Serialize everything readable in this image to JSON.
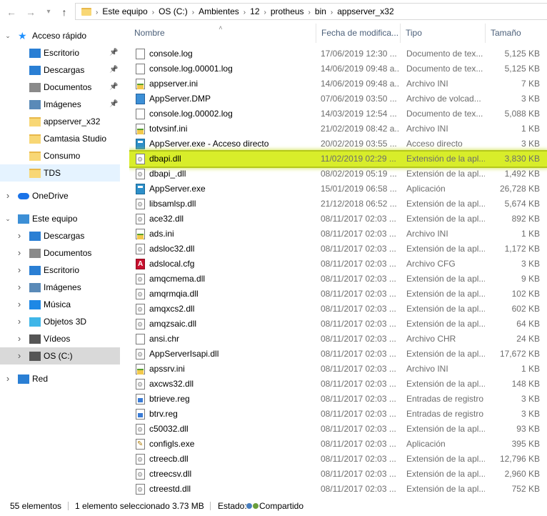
{
  "address": {
    "crumbs": [
      "Este equipo",
      "OS (C:)",
      "Ambientes",
      "12",
      "protheus",
      "bin",
      "appserver_x32"
    ]
  },
  "nav": {
    "items": [
      {
        "label": "Acceso rápido",
        "icon": "star-icon",
        "level": 0,
        "chevron": "expanded",
        "pinned": false,
        "state": ""
      },
      {
        "label": "Escritorio",
        "icon": "desktop-icon",
        "level": 1,
        "chevron": "",
        "pinned": true,
        "state": ""
      },
      {
        "label": "Descargas",
        "icon": "download-icon",
        "level": 1,
        "chevron": "",
        "pinned": true,
        "state": ""
      },
      {
        "label": "Documentos",
        "icon": "documents-icon",
        "level": 1,
        "chevron": "",
        "pinned": true,
        "state": ""
      },
      {
        "label": "Imágenes",
        "icon": "pictures-icon",
        "level": 1,
        "chevron": "",
        "pinned": true,
        "state": ""
      },
      {
        "label": "appserver_x32",
        "icon": "folder-icon",
        "level": 1,
        "chevron": "",
        "pinned": false,
        "state": ""
      },
      {
        "label": "Camtasia Studio",
        "icon": "folder-icon",
        "level": 1,
        "chevron": "",
        "pinned": false,
        "state": ""
      },
      {
        "label": "Consumo",
        "icon": "folder-icon",
        "level": 1,
        "chevron": "",
        "pinned": false,
        "state": ""
      },
      {
        "label": "TDS",
        "icon": "folder-icon",
        "level": 1,
        "chevron": "",
        "pinned": false,
        "state": "hover"
      },
      {
        "label": "OneDrive",
        "icon": "cloud-icon",
        "level": 0,
        "chevron": "collapsed",
        "pinned": false,
        "state": ""
      },
      {
        "label": "Este equipo",
        "icon": "computer-icon",
        "level": 0,
        "chevron": "expanded",
        "pinned": false,
        "state": ""
      },
      {
        "label": "Descargas",
        "icon": "download-icon",
        "level": 1,
        "chevron": "collapsed",
        "pinned": false,
        "state": ""
      },
      {
        "label": "Documentos",
        "icon": "documents-icon",
        "level": 1,
        "chevron": "collapsed",
        "pinned": false,
        "state": ""
      },
      {
        "label": "Escritorio",
        "icon": "desktop-icon",
        "level": 1,
        "chevron": "collapsed",
        "pinned": false,
        "state": ""
      },
      {
        "label": "Imágenes",
        "icon": "pictures-icon",
        "level": 1,
        "chevron": "collapsed",
        "pinned": false,
        "state": ""
      },
      {
        "label": "Música",
        "icon": "music-icon",
        "level": 1,
        "chevron": "collapsed",
        "pinned": false,
        "state": ""
      },
      {
        "label": "Objetos 3D",
        "icon": "cube-icon",
        "level": 1,
        "chevron": "collapsed",
        "pinned": false,
        "state": ""
      },
      {
        "label": "Vídeos",
        "icon": "video-icon",
        "level": 1,
        "chevron": "collapsed",
        "pinned": false,
        "state": ""
      },
      {
        "label": "OS (C:)",
        "icon": "drive-icon",
        "level": 1,
        "chevron": "collapsed",
        "pinned": false,
        "state": "selected"
      },
      {
        "label": "Red",
        "icon": "network-icon",
        "level": 0,
        "chevron": "collapsed",
        "pinned": false,
        "state": ""
      }
    ]
  },
  "columns": {
    "name": "Nombre",
    "date": "Fecha de modifica...",
    "type": "Tipo",
    "size": "Tamaño"
  },
  "files": [
    {
      "name": "console.log",
      "date": "17/06/2019 12:30 ...",
      "type": "Documento de tex...",
      "size": "5,125 KB",
      "icon": "doc"
    },
    {
      "name": "console.log.00001.log",
      "date": "14/06/2019 09:48 a...",
      "type": "Documento de tex...",
      "size": "5,125 KB",
      "icon": "doc"
    },
    {
      "name": "appserver.ini",
      "date": "14/06/2019 09:48 a...",
      "type": "Archivo INI",
      "size": "7 KB",
      "icon": "ini"
    },
    {
      "name": "AppServer.DMP",
      "date": "07/06/2019 03:50 ...",
      "type": "Archivo de volcad...",
      "size": "3 KB",
      "icon": "dmp"
    },
    {
      "name": "console.log.00002.log",
      "date": "14/03/2019 12:54 ...",
      "type": "Documento de tex...",
      "size": "5,088 KB",
      "icon": "doc"
    },
    {
      "name": "totvsinf.ini",
      "date": "21/02/2019 08:42 a...",
      "type": "Archivo INI",
      "size": "1 KB",
      "icon": "ini"
    },
    {
      "name": "AppServer.exe - Acceso directo",
      "date": "20/02/2019 03:55 ...",
      "type": "Acceso directo",
      "size": "3 KB",
      "icon": "exe"
    },
    {
      "name": "dbapi.dll",
      "date": "11/02/2019 02:29 ...",
      "type": "Extensión de la apl...",
      "size": "3,830 KB",
      "icon": "dll",
      "state": "highlight"
    },
    {
      "name": "dbapi_.dll",
      "date": "08/02/2019 05:19 ...",
      "type": "Extensión de la apl...",
      "size": "1,492 KB",
      "icon": "dll"
    },
    {
      "name": "AppServer.exe",
      "date": "15/01/2019 06:58 ...",
      "type": "Aplicación",
      "size": "26,728 KB",
      "icon": "exe"
    },
    {
      "name": "libsamlsp.dll",
      "date": "21/12/2018 06:52 ...",
      "type": "Extensión de la apl...",
      "size": "5,674 KB",
      "icon": "dll"
    },
    {
      "name": "ace32.dll",
      "date": "08/11/2017 02:03 ...",
      "type": "Extensión de la apl...",
      "size": "892 KB",
      "icon": "dll"
    },
    {
      "name": "ads.ini",
      "date": "08/11/2017 02:03 ...",
      "type": "Archivo INI",
      "size": "1 KB",
      "icon": "ini"
    },
    {
      "name": "adsloc32.dll",
      "date": "08/11/2017 02:03 ...",
      "type": "Extensión de la apl...",
      "size": "1,172 KB",
      "icon": "dll"
    },
    {
      "name": "adslocal.cfg",
      "date": "08/11/2017 02:03 ...",
      "type": "Archivo CFG",
      "size": "3 KB",
      "icon": "cfg"
    },
    {
      "name": "amqcmema.dll",
      "date": "08/11/2017 02:03 ...",
      "type": "Extensión de la apl...",
      "size": "9 KB",
      "icon": "dll"
    },
    {
      "name": "amqrmqia.dll",
      "date": "08/11/2017 02:03 ...",
      "type": "Extensión de la apl...",
      "size": "102 KB",
      "icon": "dll"
    },
    {
      "name": "amqxcs2.dll",
      "date": "08/11/2017 02:03 ...",
      "type": "Extensión de la apl...",
      "size": "602 KB",
      "icon": "dll"
    },
    {
      "name": "amqzsaic.dll",
      "date": "08/11/2017 02:03 ...",
      "type": "Extensión de la apl...",
      "size": "64 KB",
      "icon": "dll"
    },
    {
      "name": "ansi.chr",
      "date": "08/11/2017 02:03 ...",
      "type": "Archivo CHR",
      "size": "24 KB",
      "icon": "doc"
    },
    {
      "name": "AppServerIsapi.dll",
      "date": "08/11/2017 02:03 ...",
      "type": "Extensión de la apl...",
      "size": "17,672 KB",
      "icon": "dll"
    },
    {
      "name": "apssrv.ini",
      "date": "08/11/2017 02:03 ...",
      "type": "Archivo INI",
      "size": "1 KB",
      "icon": "ini"
    },
    {
      "name": "axcws32.dll",
      "date": "08/11/2017 02:03 ...",
      "type": "Extensión de la apl...",
      "size": "148 KB",
      "icon": "dll"
    },
    {
      "name": "btrieve.reg",
      "date": "08/11/2017 02:03 ...",
      "type": "Entradas de registro",
      "size": "3 KB",
      "icon": "reg"
    },
    {
      "name": "btrv.reg",
      "date": "08/11/2017 02:03 ...",
      "type": "Entradas de registro",
      "size": "3 KB",
      "icon": "reg"
    },
    {
      "name": "c50032.dll",
      "date": "08/11/2017 02:03 ...",
      "type": "Extensión de la apl...",
      "size": "93 KB",
      "icon": "dll"
    },
    {
      "name": "configls.exe",
      "date": "08/11/2017 02:03 ...",
      "type": "Aplicación",
      "size": "395 KB",
      "icon": "cfgs"
    },
    {
      "name": "ctreecb.dll",
      "date": "08/11/2017 02:03 ...",
      "type": "Extensión de la apl...",
      "size": "12,796 KB",
      "icon": "dll"
    },
    {
      "name": "ctreecsv.dll",
      "date": "08/11/2017 02:03 ...",
      "type": "Extensión de la apl...",
      "size": "2,960 KB",
      "icon": "dll"
    },
    {
      "name": "ctreestd.dll",
      "date": "08/11/2017 02:03 ...",
      "type": "Extensión de la apl...",
      "size": "752 KB",
      "icon": "dll"
    }
  ],
  "status": {
    "count": "55 elementos",
    "selection": "1 elemento seleccionado  3.73 MB",
    "state_label": "Estado:",
    "state_value": "Compartido"
  },
  "colors": {
    "selected_row": "#cce8ff",
    "highlight": "#d8ed2a",
    "nav_selected": "#d9d9d9",
    "header_text": "#4c607a"
  }
}
